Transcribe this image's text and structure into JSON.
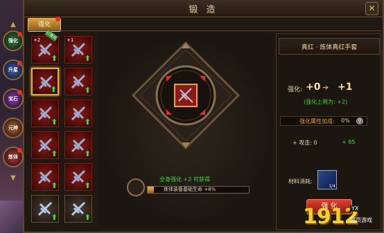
{
  "window": {
    "title": "锻 造",
    "close_label": "✕"
  },
  "tabs": [
    {
      "label": "强化"
    }
  ],
  "side_nav": {
    "up_arrow": "▲",
    "down_arrow": "▼",
    "items": [
      {
        "label": "强化",
        "color": "#2a8a3a"
      },
      {
        "label": "升星",
        "color": "#3a6ac8"
      },
      {
        "label": "宝石",
        "color": "#9a3ad0"
      },
      {
        "label": "元神",
        "color": "#c86a2a"
      },
      {
        "label": "炼体",
        "color": "#c83a3a"
      }
    ]
  },
  "grid": {
    "slots": [
      {
        "lvl": "+2",
        "ribbon": "已强化",
        "up": "⬆",
        "gray": false,
        "selected": false
      },
      {
        "lvl": "+1",
        "ribbon": "",
        "up": "⬆",
        "gray": false,
        "selected": false
      },
      {
        "lvl": "",
        "ribbon": "",
        "up": "⬆",
        "gray": false,
        "selected": true
      },
      {
        "lvl": "",
        "ribbon": "",
        "up": "⬆",
        "gray": false,
        "selected": false
      },
      {
        "lvl": "",
        "ribbon": "",
        "up": "⬆",
        "gray": false,
        "selected": false
      },
      {
        "lvl": "",
        "ribbon": "",
        "up": "⬆",
        "gray": false,
        "selected": false
      },
      {
        "lvl": "",
        "ribbon": "",
        "up": "⬆",
        "gray": false,
        "selected": false
      },
      {
        "lvl": "",
        "ribbon": "",
        "up": "⬆",
        "gray": false,
        "selected": false
      },
      {
        "lvl": "",
        "ribbon": "",
        "up": "⬆",
        "gray": false,
        "selected": false
      },
      {
        "lvl": "",
        "ribbon": "",
        "up": "⬆",
        "gray": false,
        "selected": false
      },
      {
        "lvl": "",
        "ribbon": "",
        "up": "⬆",
        "gray": true,
        "selected": false
      },
      {
        "lvl": "",
        "ribbon": "",
        "up": "⬆",
        "gray": true,
        "selected": false
      }
    ]
  },
  "center": {
    "bonus_text": "全身强化 +2 可获得",
    "progress_text": "炼体装备基础生命 +8%",
    "progress_fraction": 0.06
  },
  "right": {
    "item_name": "真红 · 炼体真红手套",
    "level_label": "强化:",
    "level_from": "+0",
    "level_arrow": "➔",
    "level_to": "+1",
    "limit_text": "(强化上限为: +2)",
    "attr_label": "强化属性加成:",
    "attr_value": "0%",
    "stat_left": "+ 攻击: 0",
    "stat_right": "+ 65",
    "material_label": "材料消耗:",
    "material_count": "1/4",
    "forge_label": "强 化"
  },
  "watermark": {
    "big": "1912",
    "small1": "YX",
    "small2": "网页游戏"
  },
  "colors": {
    "accent": "#e8b030",
    "bonus_green": "#48d048",
    "forge_red": "#e04030"
  }
}
